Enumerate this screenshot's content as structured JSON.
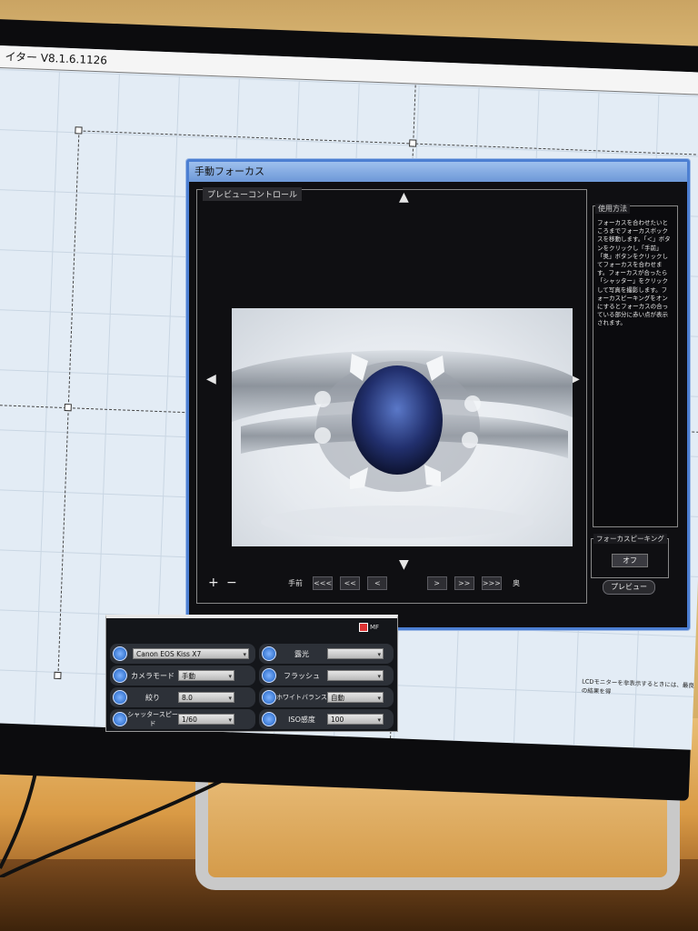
{
  "window": {
    "title": "イター V8.1.6.1126"
  },
  "dialog": {
    "title": "手動フォーカス",
    "preview_label": "プレビューコントロール",
    "nav": {
      "label_left": "手前",
      "buttons_left": [
        "<<<",
        "<<",
        "<"
      ],
      "buttons_right": [
        ">",
        ">>",
        ">>>"
      ],
      "label_right": "奥"
    },
    "zoom": {
      "plus": "+",
      "minus": "−"
    },
    "arrows": {
      "up": "▲",
      "down": "▼",
      "left": "◀",
      "right": "▶"
    },
    "help": {
      "title": "使用方法",
      "text": "フォーカスを合わせたいところまでフォーカスボックスを移動します。「＜」ボタンをクリックし「手前」「奥」ボタンをクリックしてフォーカスを合わせます。フォーカスが合ったら「シャッター」をクリックして写真を撮影します。フォーカスピーキングをオンにするとフォーカスの合っている部分に赤い点が表示されます。"
    },
    "peaking": {
      "title": "フォーカスピーキング",
      "button": "オフ"
    },
    "preview_button": "プレビュー"
  },
  "camera_panel": {
    "mode_badge": "MF",
    "left": [
      {
        "label": "",
        "value": "Canon EOS Kiss X7",
        "icon": "camera-icon"
      },
      {
        "label": "カメラモード",
        "value": "手動",
        "icon": "mode-icon"
      },
      {
        "label": "絞り",
        "value": "8.0",
        "icon": "aperture-icon"
      },
      {
        "label": "シャッタースピード",
        "value": "1/60",
        "icon": "shutter-icon"
      }
    ],
    "right": [
      {
        "label": "露光",
        "value": "",
        "icon": "exposure-icon"
      },
      {
        "label": "フラッシュ",
        "value": "",
        "icon": "flash-icon"
      },
      {
        "label": "ホワイトバランス",
        "value": "自動",
        "icon": "white-balance-icon"
      },
      {
        "label": "ISO感度",
        "value": "100",
        "icon": "iso-icon"
      }
    ]
  },
  "lcd_message": "LCDモニターを非表示するときには、最良の結果を得"
}
